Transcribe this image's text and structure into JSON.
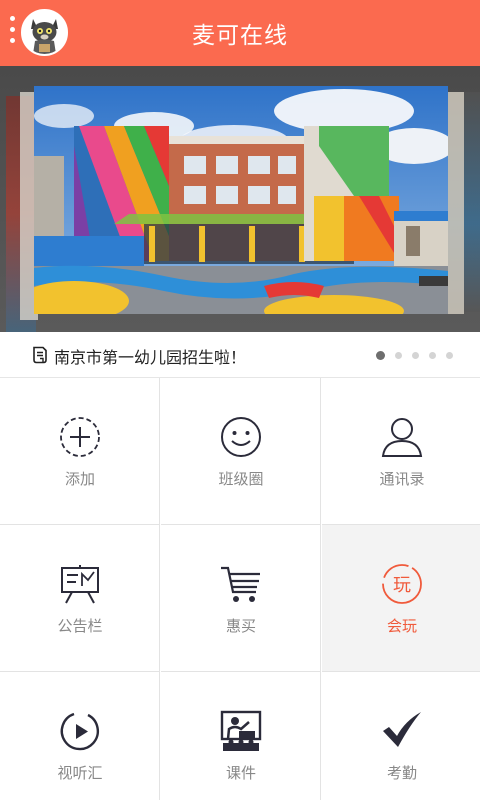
{
  "header": {
    "title": "麦可在线"
  },
  "notice": {
    "text": "南京市第一幼儿园招生啦！",
    "pages": 5,
    "active_page": 1
  },
  "grid": {
    "items": [
      {
        "label": "添加",
        "icon": "add-circle-icon"
      },
      {
        "label": "班级圈",
        "icon": "smiley-icon"
      },
      {
        "label": "通讯录",
        "icon": "person-icon"
      },
      {
        "label": "公告栏",
        "icon": "bulletin-board-icon"
      },
      {
        "label": "惠买",
        "icon": "shopping-cart-icon"
      },
      {
        "label": "会玩",
        "icon": "play-circle-text-icon",
        "glyph": "玩"
      },
      {
        "label": "视听汇",
        "icon": "play-button-icon"
      },
      {
        "label": "课件",
        "icon": "presentation-icon"
      },
      {
        "label": "考勤",
        "icon": "checkmark-icon"
      }
    ]
  },
  "colors": {
    "brand": "#fb6a4f",
    "highlight_label": "#f05a3b",
    "icon_dark": "#2b2b3a",
    "label_gray": "#888888"
  }
}
